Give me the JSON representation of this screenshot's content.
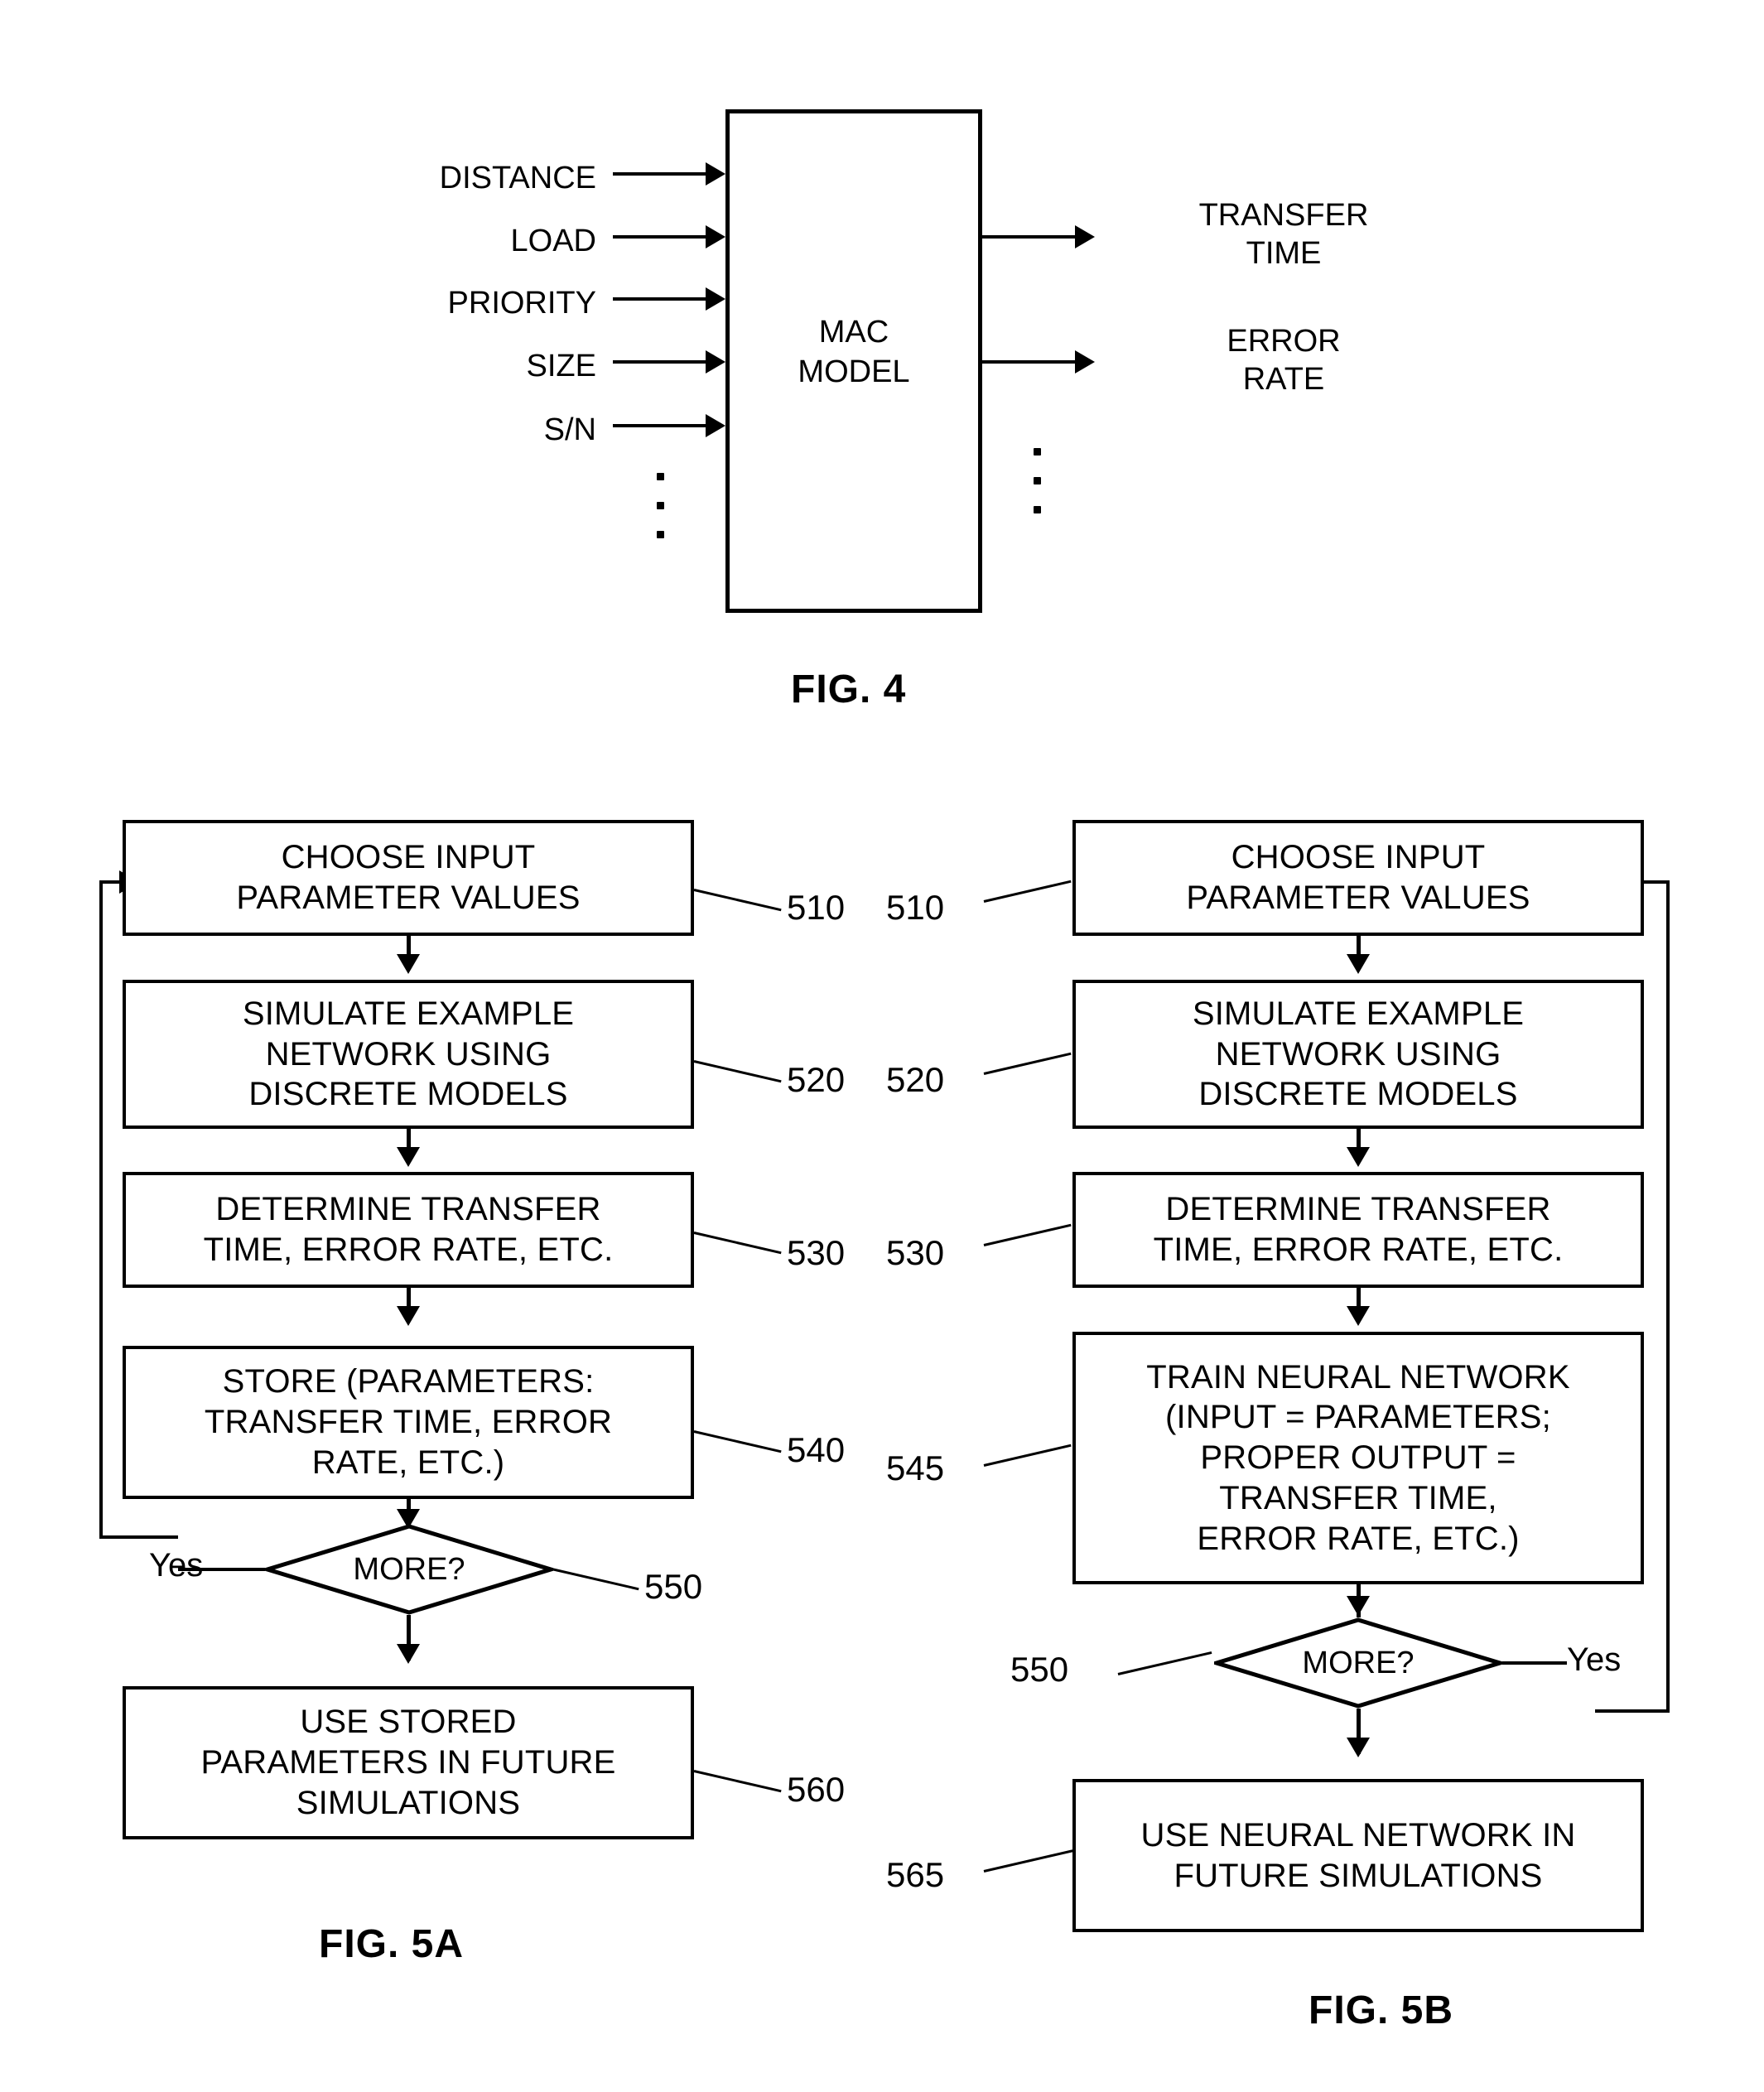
{
  "figure4": {
    "caption": "FIG. 4",
    "block_label": "MAC\nMODEL",
    "inputs": [
      {
        "label": "DISTANCE"
      },
      {
        "label": "LOAD"
      },
      {
        "label": "PRIORITY"
      },
      {
        "label": "SIZE"
      },
      {
        "label": "S/N"
      }
    ],
    "input_ellipsis": "vertical-ellipsis",
    "outputs": [
      {
        "label": "TRANSFER\nTIME"
      },
      {
        "label": "ERROR\nRATE"
      }
    ],
    "output_ellipsis": "vertical-ellipsis"
  },
  "figure5a": {
    "caption": "FIG. 5A",
    "steps": [
      {
        "ref": "510",
        "text": "CHOOSE INPUT\nPARAMETER VALUES"
      },
      {
        "ref": "520",
        "text": "SIMULATE EXAMPLE\nNETWORK USING\nDISCRETE MODELS"
      },
      {
        "ref": "530",
        "text": "DETERMINE TRANSFER\nTIME, ERROR RATE, ETC."
      },
      {
        "ref": "540",
        "text": "STORE (PARAMETERS:\nTRANSFER TIME, ERROR\nRATE, ETC.)"
      }
    ],
    "decision": {
      "ref": "550",
      "text": "MORE?",
      "branch_label": "Yes"
    },
    "final": {
      "ref": "560",
      "text": "USE STORED\nPARAMETERS IN FUTURE\nSIMULATIONS"
    }
  },
  "figure5b": {
    "caption": "FIG. 5B",
    "steps": [
      {
        "ref": "510",
        "text": "CHOOSE INPUT\nPARAMETER VALUES"
      },
      {
        "ref": "520",
        "text": "SIMULATE EXAMPLE\nNETWORK USING\nDISCRETE MODELS"
      },
      {
        "ref": "530",
        "text": "DETERMINE TRANSFER\nTIME, ERROR RATE, ETC."
      },
      {
        "ref": "545",
        "text": "TRAIN NEURAL NETWORK\n(INPUT = PARAMETERS;\nPROPER OUTPUT =\nTRANSFER TIME,\nERROR RATE, ETC.)"
      }
    ],
    "decision": {
      "ref": "550",
      "text": "MORE?",
      "branch_label": "Yes"
    },
    "final": {
      "ref": "565",
      "text": "USE NEURAL NETWORK IN\nFUTURE SIMULATIONS"
    }
  },
  "colors": {
    "ink": "#000000",
    "paper": "#ffffff"
  }
}
